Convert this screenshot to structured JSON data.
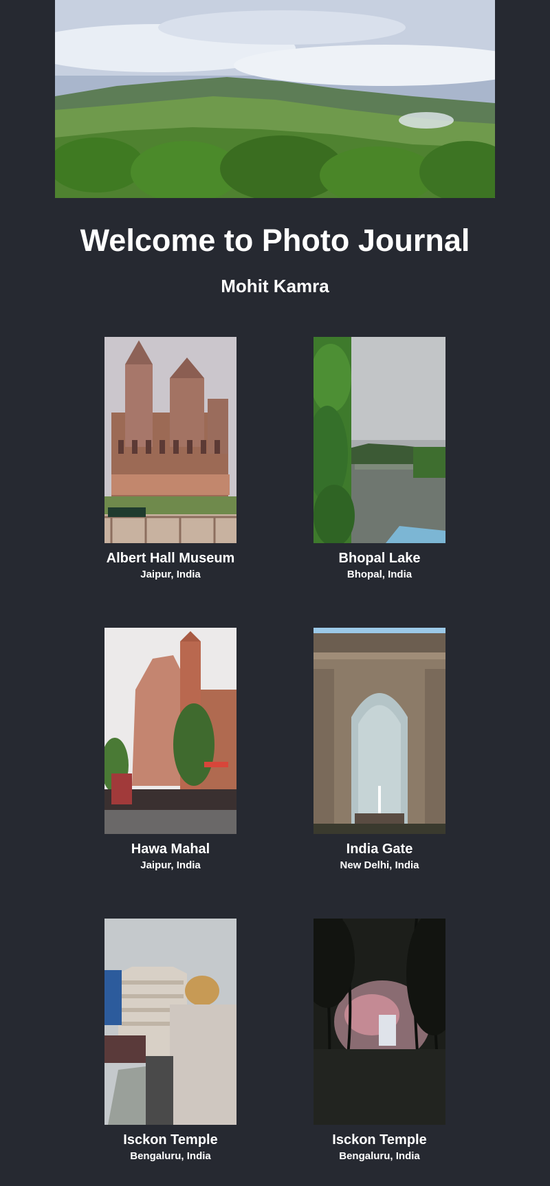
{
  "page": {
    "title": "Welcome to Photo Journal",
    "author": "Mohit Kamra"
  },
  "hero": {
    "alt": "mountain-landscape"
  },
  "gallery": [
    {
      "title": "Albert Hall Museum",
      "location": "Jaipur, India"
    },
    {
      "title": "Bhopal Lake",
      "location": "Bhopal, India"
    },
    {
      "title": "Hawa Mahal",
      "location": "Jaipur, India"
    },
    {
      "title": "India Gate",
      "location": "New Delhi, India"
    },
    {
      "title": "Isckon Temple",
      "location": "Bengaluru, India"
    },
    {
      "title": "Isckon Temple",
      "location": "Bengaluru, India"
    }
  ],
  "colors": {
    "background": "#262931",
    "text": "#ffffff"
  }
}
